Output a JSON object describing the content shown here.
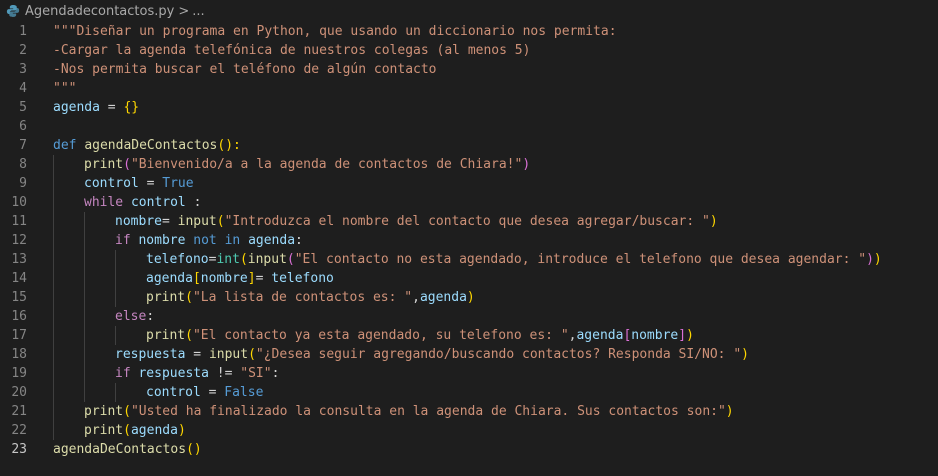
{
  "breadcrumb": {
    "file_name": "Agendadecontactos.py",
    "separator": ">",
    "more": "..."
  },
  "colors": {
    "background": "#1e1e1e",
    "line_number": "#858585",
    "line_number_active": "#c6c6c6",
    "string": "#ce9178",
    "keyword": "#569cd6",
    "control": "#c586c0",
    "function": "#dcdcaa",
    "variable": "#9cdcfe",
    "builtin": "#4ec9b0",
    "brace": "#ffd700",
    "bracket": "#da70d6",
    "plain": "#d4d4d4"
  },
  "current_line": 23,
  "lines": [
    {
      "n": "1",
      "indent": 0,
      "tokens": [
        [
          "\"\"\"Diseñar un programa en Python, que usando un diccionario nos permita:",
          "string"
        ]
      ]
    },
    {
      "n": "2",
      "indent": 0,
      "tokens": [
        [
          "-Cargar la agenda telefónica de nuestros colegas (al menos 5)",
          "string"
        ]
      ]
    },
    {
      "n": "3",
      "indent": 0,
      "tokens": [
        [
          "-Nos permita buscar el teléfono de algún contacto",
          "string"
        ]
      ]
    },
    {
      "n": "4",
      "indent": 0,
      "tokens": [
        [
          "\"\"\"",
          "string"
        ]
      ]
    },
    {
      "n": "5",
      "indent": 0,
      "tokens": [
        [
          "agenda",
          "variable"
        ],
        [
          " = ",
          "plain"
        ],
        [
          "{}",
          "brace"
        ]
      ]
    },
    {
      "n": "6",
      "indent": 0,
      "tokens": []
    },
    {
      "n": "7",
      "indent": 0,
      "tokens": [
        [
          "def",
          "keyword"
        ],
        [
          " ",
          "plain"
        ],
        [
          "agendaDeContactos",
          "function"
        ],
        [
          "():",
          "brace"
        ]
      ]
    },
    {
      "n": "8",
      "indent": 1,
      "tokens": [
        [
          "print",
          "function"
        ],
        [
          "(",
          "bracket"
        ],
        [
          "\"Bienvenido/a a la agenda de contactos de Chiara!\"",
          "string"
        ],
        [
          ")",
          "bracket"
        ]
      ]
    },
    {
      "n": "9",
      "indent": 1,
      "tokens": [
        [
          "control",
          "variable"
        ],
        [
          " = ",
          "plain"
        ],
        [
          "True",
          "keyword"
        ]
      ]
    },
    {
      "n": "10",
      "indent": 1,
      "tokens": [
        [
          "while",
          "control"
        ],
        [
          " ",
          "plain"
        ],
        [
          "control",
          "variable"
        ],
        [
          " :",
          "plain"
        ]
      ]
    },
    {
      "n": "11",
      "indent": 2,
      "tokens": [
        [
          "nombre",
          "variable"
        ],
        [
          "= ",
          "plain"
        ],
        [
          "input",
          "function"
        ],
        [
          "(",
          "brace"
        ],
        [
          "\"Introduzca el nombre del contacto que desea agregar/buscar: \"",
          "string"
        ],
        [
          ")",
          "brace"
        ]
      ]
    },
    {
      "n": "12",
      "indent": 2,
      "tokens": [
        [
          "if",
          "control"
        ],
        [
          " ",
          "plain"
        ],
        [
          "nombre",
          "variable"
        ],
        [
          " ",
          "plain"
        ],
        [
          "not in",
          "keyword"
        ],
        [
          " ",
          "plain"
        ],
        [
          "agenda",
          "variable"
        ],
        [
          ":",
          "plain"
        ]
      ]
    },
    {
      "n": "13",
      "indent": 3,
      "tokens": [
        [
          "telefono",
          "variable"
        ],
        [
          "=",
          "plain"
        ],
        [
          "int",
          "builtin"
        ],
        [
          "(",
          "brace"
        ],
        [
          "input",
          "function"
        ],
        [
          "(",
          "bracket"
        ],
        [
          "\"El contacto no esta agendado, introduce el telefono que desea agendar: \"",
          "string"
        ],
        [
          ")",
          "bracket"
        ],
        [
          ")",
          "brace"
        ]
      ]
    },
    {
      "n": "14",
      "indent": 3,
      "tokens": [
        [
          "agenda",
          "variable"
        ],
        [
          "[",
          "brace"
        ],
        [
          "nombre",
          "variable"
        ],
        [
          "]",
          "brace"
        ],
        [
          "= ",
          "plain"
        ],
        [
          "telefono",
          "variable"
        ]
      ]
    },
    {
      "n": "15",
      "indent": 3,
      "tokens": [
        [
          "print",
          "function"
        ],
        [
          "(",
          "brace"
        ],
        [
          "\"La lista de contactos es: \"",
          "string"
        ],
        [
          ",",
          "plain"
        ],
        [
          "agenda",
          "variable"
        ],
        [
          ")",
          "brace"
        ]
      ]
    },
    {
      "n": "16",
      "indent": 2,
      "tokens": [
        [
          "else",
          "control"
        ],
        [
          ":",
          "plain"
        ]
      ]
    },
    {
      "n": "17",
      "indent": 3,
      "tokens": [
        [
          "print",
          "function"
        ],
        [
          "(",
          "brace"
        ],
        [
          "\"El contacto ya esta agendado, su telefono es: \"",
          "string"
        ],
        [
          ",",
          "plain"
        ],
        [
          "agenda",
          "variable"
        ],
        [
          "[",
          "bracket"
        ],
        [
          "nombre",
          "variable"
        ],
        [
          "]",
          "bracket"
        ],
        [
          ")",
          "brace"
        ]
      ]
    },
    {
      "n": "18",
      "indent": 2,
      "tokens": [
        [
          "respuesta",
          "variable"
        ],
        [
          " = ",
          "plain"
        ],
        [
          "input",
          "function"
        ],
        [
          "(",
          "brace"
        ],
        [
          "\"¿Desea seguir agregando/buscando contactos? Responda SI/NO: \"",
          "string"
        ],
        [
          ")",
          "brace"
        ]
      ]
    },
    {
      "n": "19",
      "indent": 2,
      "tokens": [
        [
          "if",
          "control"
        ],
        [
          " ",
          "plain"
        ],
        [
          "respuesta",
          "variable"
        ],
        [
          " != ",
          "plain"
        ],
        [
          "\"SI\"",
          "string"
        ],
        [
          ":",
          "plain"
        ]
      ]
    },
    {
      "n": "20",
      "indent": 3,
      "tokens": [
        [
          "control",
          "variable"
        ],
        [
          " = ",
          "plain"
        ],
        [
          "False",
          "keyword"
        ]
      ]
    },
    {
      "n": "21",
      "indent": 1,
      "tokens": [
        [
          "print",
          "function"
        ],
        [
          "(",
          "brace"
        ],
        [
          "\"Usted ha finalizado la consulta en la agenda de Chiara. Sus contactos son:\"",
          "string"
        ],
        [
          ")",
          "brace"
        ]
      ]
    },
    {
      "n": "22",
      "indent": 1,
      "tokens": [
        [
          "print",
          "function"
        ],
        [
          "(",
          "brace"
        ],
        [
          "agenda",
          "variable"
        ],
        [
          ")",
          "brace"
        ]
      ]
    },
    {
      "n": "23",
      "indent": 0,
      "tokens": [
        [
          "agendaDeContactos",
          "function"
        ],
        [
          "()",
          "brace"
        ]
      ]
    }
  ]
}
